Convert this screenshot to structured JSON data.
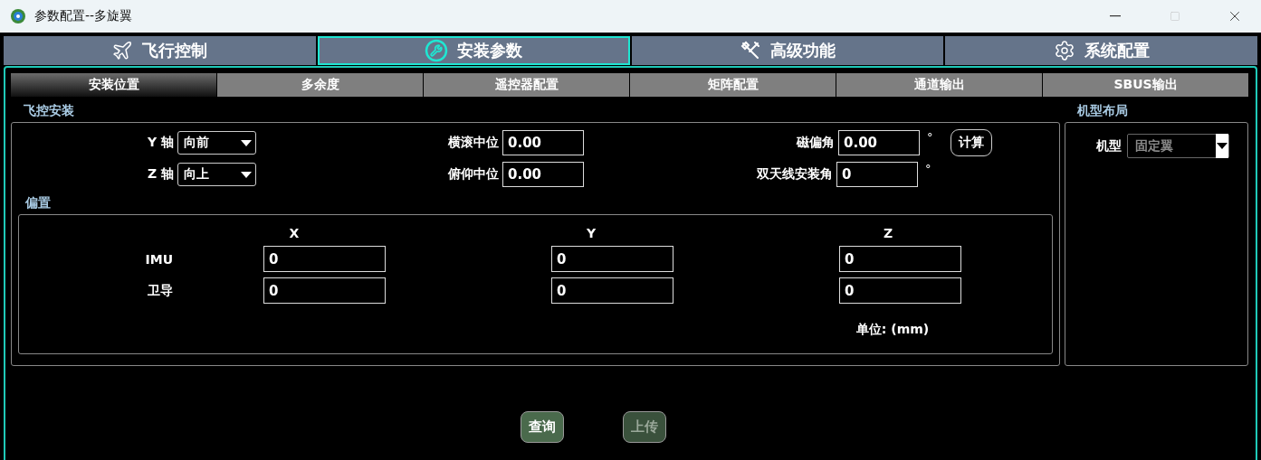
{
  "window": {
    "title": "参数配置--多旋翼"
  },
  "main_tabs": [
    {
      "label": "飞行控制",
      "selected": false
    },
    {
      "label": "安装参数",
      "selected": true
    },
    {
      "label": "高级功能",
      "selected": false
    },
    {
      "label": "系统配置",
      "selected": false
    }
  ],
  "sub_tabs": [
    {
      "label": "安装位置",
      "selected": true
    },
    {
      "label": "多余度",
      "selected": false
    },
    {
      "label": "遥控器配置",
      "selected": false
    },
    {
      "label": "矩阵配置",
      "selected": false
    },
    {
      "label": "通道输出",
      "selected": false
    },
    {
      "label": "SBUS输出",
      "selected": false
    }
  ],
  "mount_group": {
    "title": "飞控安装",
    "columns": [
      [
        {
          "kind": "select",
          "label": "Y 轴",
          "value": "向前"
        },
        {
          "kind": "select",
          "label": "Z 轴",
          "value": "向上"
        }
      ],
      [
        {
          "kind": "input",
          "label": "横滚中位",
          "value": "0.00"
        },
        {
          "kind": "input",
          "label": "俯仰中位",
          "value": "0.00"
        }
      ],
      [
        {
          "kind": "input",
          "label": "磁偏角",
          "value": "0.00",
          "unit": "°",
          "button": "计算"
        },
        {
          "kind": "input",
          "label": "双天线安装角",
          "value": "0",
          "unit": "°"
        }
      ]
    ],
    "offset_group": {
      "title": "偏置",
      "headers": [
        "X",
        "Y",
        "Z"
      ],
      "rows": [
        {
          "label": "IMU",
          "values": [
            "0",
            "0",
            "0"
          ]
        },
        {
          "label": "卫导",
          "values": [
            "0",
            "0",
            "0"
          ]
        }
      ],
      "unit_note": "单位: (mm)"
    }
  },
  "layout_group": {
    "title": "机型布局",
    "label": "机型",
    "value": "固定翼",
    "disabled": true
  },
  "buttons": [
    {
      "label": "查询",
      "disabled": false
    },
    {
      "label": "上传",
      "disabled": true
    }
  ]
}
